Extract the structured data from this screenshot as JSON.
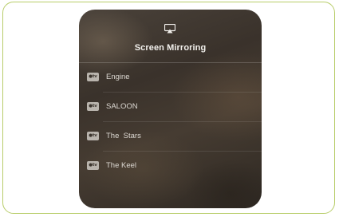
{
  "panel": {
    "icon": "airplay-icon",
    "title": "Screen Mirroring"
  },
  "devices": [
    {
      "label": "Engine",
      "icon": "apple-tv-icon",
      "icon_text": "●tv"
    },
    {
      "label": "SALOON",
      "icon": "apple-tv-icon",
      "icon_text": "●tv"
    },
    {
      "label": "The  Stars",
      "icon": "apple-tv-icon",
      "icon_text": "●tv"
    },
    {
      "label": "The Keel",
      "icon": "apple-tv-icon",
      "icon_text": "●tv"
    }
  ]
}
